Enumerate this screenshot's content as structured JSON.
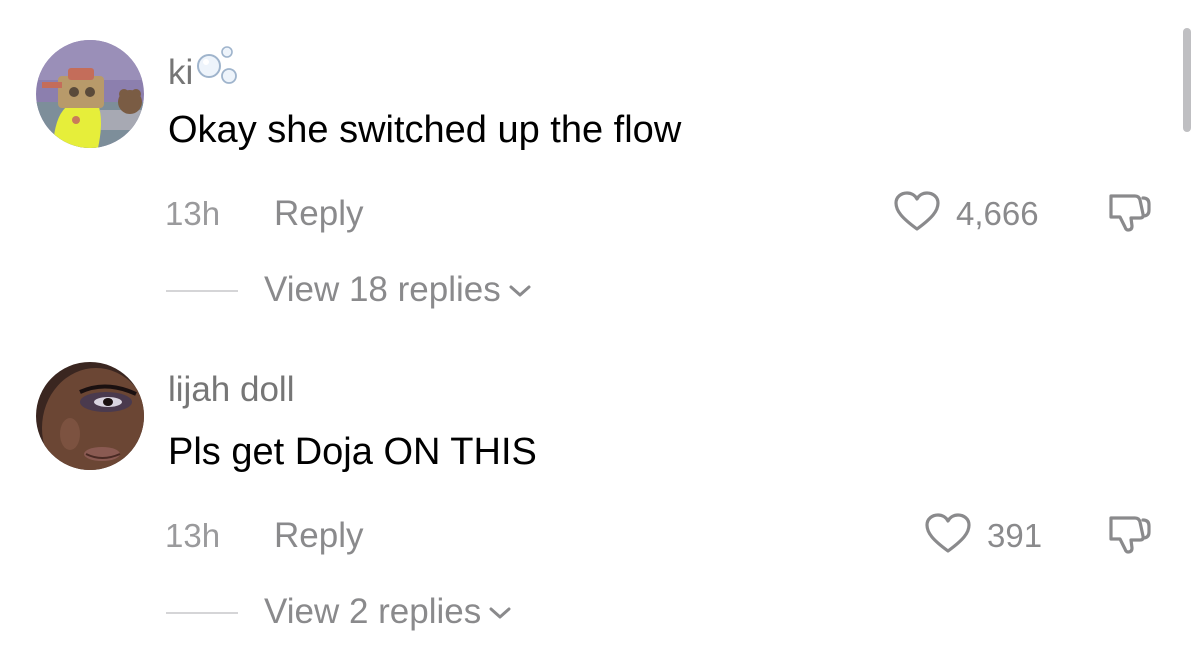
{
  "comments": [
    {
      "username": "ki",
      "text": "Okay she switched up the flow",
      "time": "13h",
      "reply_label": "Reply",
      "likes": "4,666",
      "view_replies": "View 18 replies"
    },
    {
      "username": "lijah doll",
      "text": "Pls get Doja ON THIS",
      "time": "13h",
      "reply_label": "Reply",
      "likes": "391",
      "view_replies": "View 2 replies"
    }
  ],
  "colors": {
    "muted": "#8a8a8c",
    "text": "#000000",
    "scrollbar": "#bfbfc2"
  }
}
